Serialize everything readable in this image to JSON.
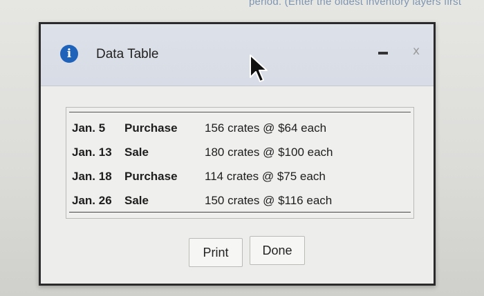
{
  "background": {
    "text": "period. (Enter the oldest inventory layers first"
  },
  "dialog": {
    "title": "Data Table",
    "icons": {
      "info": "info-icon",
      "minimize": "minimize-icon",
      "close": "close-icon"
    },
    "close_glyph": "x",
    "info_glyph": "i",
    "rows": [
      {
        "date": "Jan. 5",
        "type": "Purchase",
        "detail": "156 crates @ $64 each"
      },
      {
        "date": "Jan. 13",
        "type": "Sale",
        "detail": "180 crates @ $100 each"
      },
      {
        "date": "Jan. 18",
        "type": "Purchase",
        "detail": "114 crates @ $75 each"
      },
      {
        "date": "Jan. 26",
        "type": "Sale",
        "detail": "150 crates @ $116 each"
      }
    ],
    "buttons": {
      "print": "Print",
      "done": "Done"
    }
  },
  "colors": {
    "info_icon": "#1f62b9",
    "titlebar": "#d7dce6",
    "background_text": "#7e95b2"
  }
}
